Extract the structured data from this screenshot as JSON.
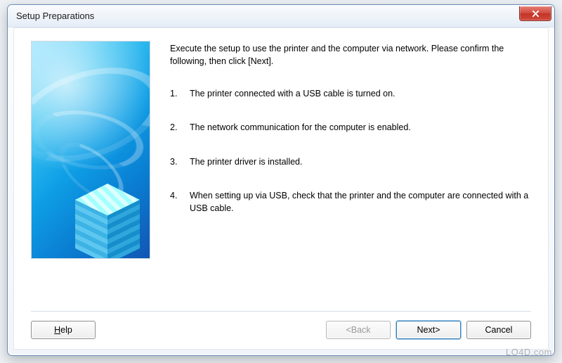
{
  "window": {
    "title": "Setup Preparations"
  },
  "content": {
    "intro": "Execute the setup to use the printer and the computer via network. Please confirm the following, then click [Next].",
    "steps": [
      "The printer connected with a USB cable is turned on.",
      "The network communication for the computer is enabled.",
      "The printer driver is installed.",
      "When setting up via USB, check that the printer and the computer are connected with a USB cable."
    ]
  },
  "buttons": {
    "help": "Help",
    "back": "<Back",
    "next": "Next>",
    "cancel": "Cancel"
  },
  "watermark": "LO4D.com"
}
